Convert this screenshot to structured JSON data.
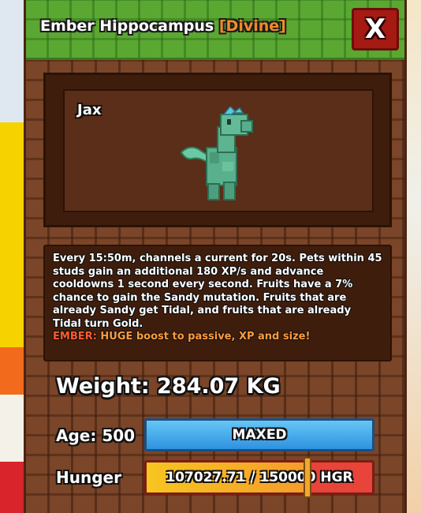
{
  "pet": {
    "name": "Ember Hippocampus",
    "rarity": "[Divine]",
    "owner": "Jax",
    "close_label": "X"
  },
  "description": {
    "text": "Every 15:50m, channels a current for 20s. Pets within 45 studs gain an additional 180 XP/s and advance cooldowns 1 second every second. Fruits have a 7% chance to gain the Sandy mutation. Fruits that are already Sandy get Tidal, and fruits that are already Tidal turn Gold.",
    "mutation_name": "EMBER:",
    "mutation_text": " HUGE boost to passive, XP and size!"
  },
  "stats": {
    "weight": "Weight: 284.07 KG",
    "age_label": "Age: 500",
    "age_bar_text": "MAXED",
    "hunger_label": "Hunger",
    "hunger_text": "107027.71 / 150000 HGR",
    "hunger_fraction": 0.7135
  },
  "colors": {
    "header_green": "#5aa832",
    "panel_brown": "#7a4528",
    "rarity_orange": "#f08a28",
    "close_red": "#a51a12",
    "age_blue": "#2e92e0",
    "hunger_yellow": "#f7c520",
    "hunger_red": "#e8443a",
    "mutation_orange": "#ff5a2a"
  },
  "icons": {
    "pet_model": "hippocampus-model-icon"
  }
}
